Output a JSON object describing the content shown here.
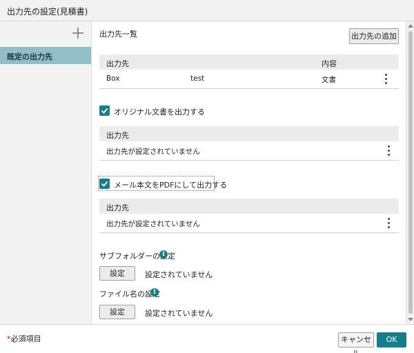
{
  "window": {
    "title": "出力先の設定(見積書)"
  },
  "sidebar": {
    "add_icon": "plus-icon",
    "items": [
      {
        "label": "既定の出力先"
      }
    ]
  },
  "main": {
    "list_label": "出力先一覧",
    "add_button": "出力先の追加",
    "destinations": {
      "columns": [
        "出力先",
        "内容"
      ],
      "rows": [
        {
          "destination": "Box",
          "name": "test",
          "content": "文書"
        }
      ]
    },
    "original_doc": {
      "checkbox_label": "オリジナル文書を出力する",
      "checked": true,
      "column": "出力先",
      "value": "出力先が設定されていません"
    },
    "mail_body": {
      "checkbox_label": "メール本文をPDFにして出力する",
      "checked": true,
      "column": "出力先",
      "value": "出力先が設定されていません"
    },
    "subfolder": {
      "label": "サブフォルダーの設定",
      "button": "設定",
      "value": "設定されていません"
    },
    "filename": {
      "label": "ファイル名の設定",
      "button": "設定",
      "value": "設定されていません"
    }
  },
  "footer": {
    "required_mark": "*",
    "required_text": "必須項目",
    "cancel": "キャンセル",
    "ok": "OK"
  },
  "colors": {
    "accent": "#177d8b",
    "sidebar_selected": "#93bec7"
  }
}
